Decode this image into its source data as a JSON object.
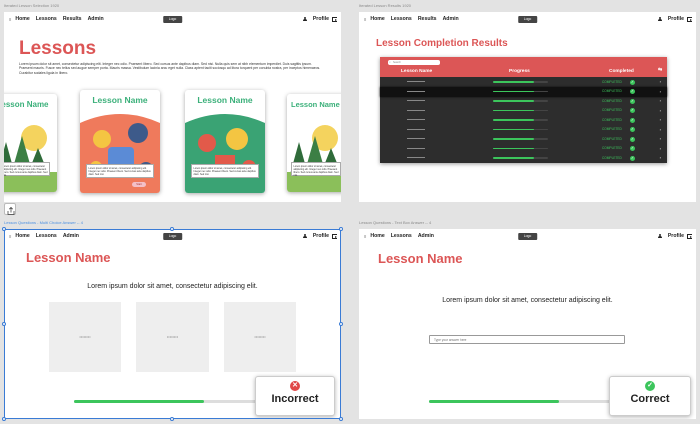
{
  "frames": {
    "f1_label": "Iterated Lesson Selection 1920",
    "f2_label": "Iterated Lesson Results 1920",
    "f3_label": "Lesson Questions - Multi Choice Answer -- 4",
    "f4_label": "Lesson Questions - Text Box Answer -- 4"
  },
  "nav": {
    "home": "Home",
    "lessons": "Lessons",
    "results": "Results",
    "admin": "Admin",
    "logo": "Logo",
    "profile": "Profile"
  },
  "selection": {
    "title": "Lessons",
    "intro": "Lorem ipsum dolor sit amet, consectetur adipiscing elit. Integer nec odio. Praesent libero. Sed cursus ante dapibus diam. Sed nisi. Nulla quis sem at nibh elementum imperdiet. Duis sagittis ipsum. Praesent mauris. Fusce nec tellus sed augue semper porta. Mauris massa. Vestibulum lacinia arcu eget nulla. Class aptent taciti sociosqu ad litora torquent per conubia nostra, per inceptos himenaeos. Curabitur sodales ligula in libero.",
    "card_title": "Lesson Name",
    "card_desc": "Lorem ipsum dolor sit amet, consectetur adipiscing elit. Integer nec odio. Praesent libero. Sed cursus ante dapibus diam. Sed nisi.",
    "card_button": "Start"
  },
  "results": {
    "title": "Lesson Completion Results",
    "search_placeholder": "Search",
    "col_name": "Lesson Name",
    "col_progress": "Progress",
    "col_completed": "Completed",
    "status": "COMPLETED",
    "rows": 9,
    "progress_fraction": 0.75
  },
  "question": {
    "lesson_title": "Lesson Name",
    "prompt": "Lorem ipsum dolor sit amet, consectetur adipiscing elit.",
    "option_text": "••••••••",
    "text_placeholder": "Type your answer here",
    "incorrect": "Incorrect",
    "correct": "Correct",
    "progress_fraction": 0.65
  },
  "colors": {
    "accent_red": "#dc5656",
    "green": "#3cc55c",
    "card_green": "#3bb07a",
    "selection_blue": "#3a7bd5"
  }
}
